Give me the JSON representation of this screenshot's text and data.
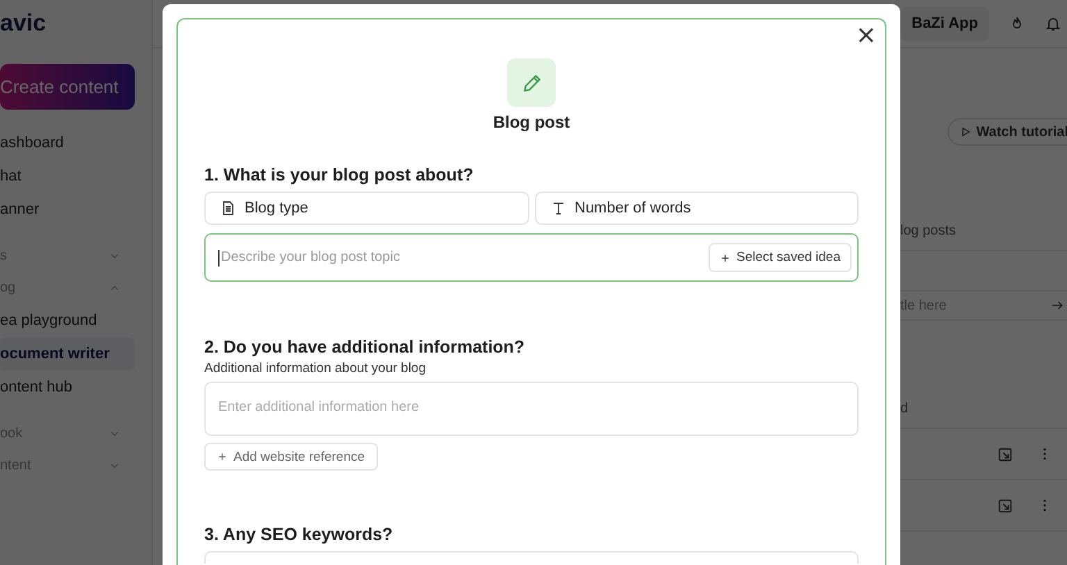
{
  "app": {
    "logo": "avic",
    "create_button": "Create content",
    "nav": [
      {
        "kind": "link",
        "label": "ashboard",
        "selected": false
      },
      {
        "kind": "link",
        "label": "hat",
        "selected": false
      },
      {
        "kind": "link",
        "label": "anner",
        "selected": false
      },
      {
        "kind": "section",
        "label": "s",
        "expanded": false
      },
      {
        "kind": "section",
        "label": "og",
        "expanded": true
      },
      {
        "kind": "link",
        "label": "ea playground",
        "selected": false
      },
      {
        "kind": "link",
        "label": "ocument writer",
        "selected": true
      },
      {
        "kind": "link",
        "label": "ontent hub",
        "selected": false
      },
      {
        "kind": "section",
        "label": "ook",
        "expanded": false
      },
      {
        "kind": "section",
        "label": "ntent",
        "expanded": false
      }
    ],
    "workspace_button": "BaZi App",
    "tutorial_button": "Watch tutorial",
    "tab_label": "log posts",
    "title_field": {
      "placeholder": "tle here"
    },
    "list_label": "d"
  },
  "modal": {
    "title": "Blog post",
    "close": "×",
    "section_1": {
      "heading": "1. What is your blog post about?",
      "selectors": [
        "Blog type",
        "Number of words"
      ],
      "topic_field": {
        "placeholder": "Describe your blog post topic",
        "focused": true
      },
      "saved_idea_button": "Select saved idea"
    },
    "section_2": {
      "heading": "2. Do you have additional information?",
      "label": "Additional information about your blog",
      "field": {
        "placeholder": "Enter additional information here"
      },
      "reference_button": "Add website reference"
    },
    "section_3": {
      "heading": "3. Any SEO keywords?"
    }
  }
}
